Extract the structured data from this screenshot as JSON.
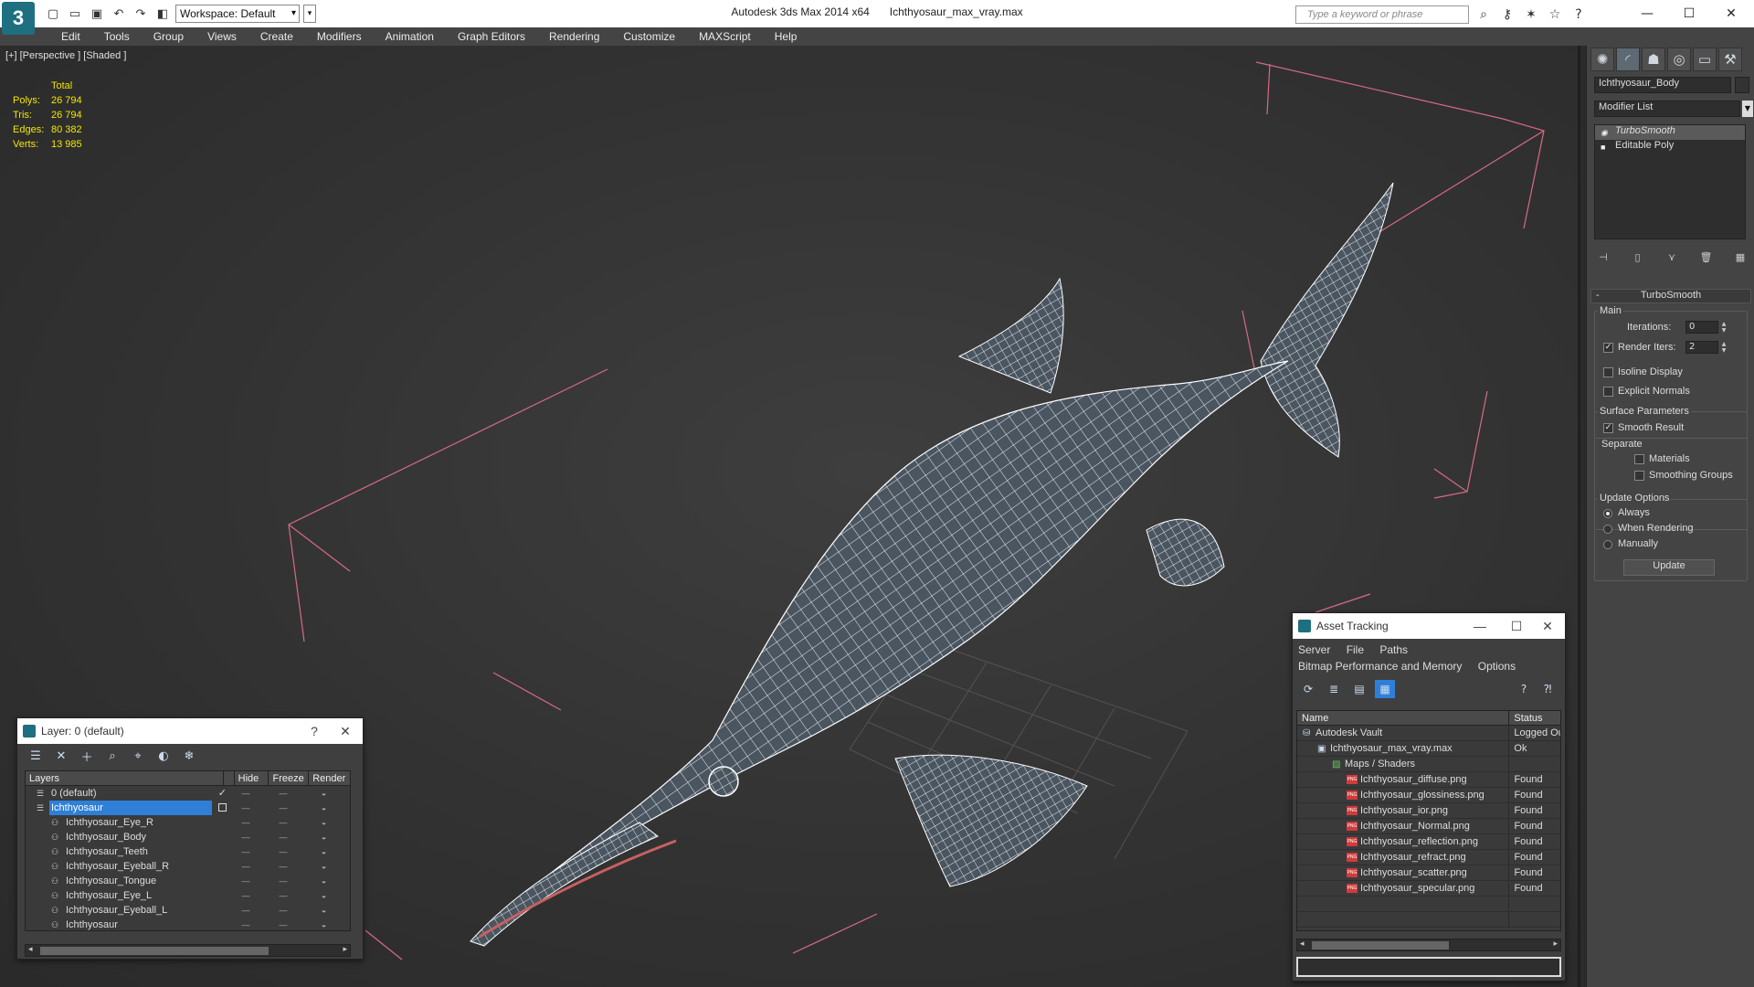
{
  "titlebar": {
    "app_name": "Autodesk 3ds Max 2014 x64",
    "file_name": "Ichthyosaur_max_vray.max",
    "workspace": "Workspace: Default",
    "search_placeholder": "Type a keyword or phrase",
    "logo_glyph": "3",
    "controls": {
      "minimize": "—",
      "maximize": "☐",
      "close": "✕"
    }
  },
  "menu": {
    "items": [
      "Edit",
      "Tools",
      "Group",
      "Views",
      "Create",
      "Modifiers",
      "Animation",
      "Graph Editors",
      "Rendering",
      "Customize",
      "MAXScript",
      "Help"
    ]
  },
  "viewport": {
    "label": "[+] [Perspective ] [Shaded ]",
    "stats": {
      "header": "Total",
      "rows": [
        {
          "key": "Polys:",
          "value": "26 794"
        },
        {
          "key": "Tris:",
          "value": "26 794"
        },
        {
          "key": "Edges:",
          "value": "80 382"
        },
        {
          "key": "Verts:",
          "value": "13 985"
        }
      ]
    },
    "colors": {
      "stats": "#f4e600",
      "bbox": "#d86a86",
      "wire": "#ffffff"
    }
  },
  "command_panel": {
    "object_name": "Ichthyosaur_Body",
    "modifier_list": "Modifier List",
    "stack": [
      "TurboSmooth",
      "Editable Poly"
    ],
    "rollout_title": "TurboSmooth",
    "main_group": "Main",
    "iterations_label": "Iterations:",
    "iterations_value": "0",
    "render_iters_label": "Render Iters:",
    "render_iters_value": "2",
    "isoline_label": "Isoline Display",
    "explicit_normals_label": "Explicit Normals",
    "surface_group": "Surface Parameters",
    "smooth_result_label": "Smooth Result",
    "separate_label": "Separate",
    "materials_label": "Materials",
    "smoothing_groups_label": "Smoothing Groups",
    "update_group": "Update Options",
    "always_label": "Always",
    "when_rendering_label": "When Rendering",
    "manually_label": "Manually",
    "update_button": "Update"
  },
  "layer_window": {
    "title": "Layer: 0 (default)",
    "help": "?",
    "close": "✕",
    "columns": [
      "Layers",
      "Hide",
      "Freeze",
      "Render"
    ],
    "rows": [
      {
        "name": "0 (default)",
        "level": 1,
        "check": "✓"
      },
      {
        "name": "Ichthyosaur",
        "level": 1,
        "selected": true
      },
      {
        "name": "Ichthyosaur_Eye_R",
        "level": 2
      },
      {
        "name": "Ichthyosaur_Body",
        "level": 2
      },
      {
        "name": "Ichthyosaur_Teeth",
        "level": 2
      },
      {
        "name": "Ichthyosaur_Eyeball_R",
        "level": 2
      },
      {
        "name": "Ichthyosaur_Tongue",
        "level": 2
      },
      {
        "name": "Ichthyosaur_Eye_L",
        "level": 2
      },
      {
        "name": "Ichthyosaur_Eyeball_L",
        "level": 2
      },
      {
        "name": "Ichthyosaur",
        "level": 2
      }
    ]
  },
  "asset_window": {
    "title": "Asset Tracking",
    "menu_row1": [
      "Server",
      "File",
      "Paths"
    ],
    "menu_row2": [
      "Bitmap Performance and Memory",
      "Options"
    ],
    "columns": [
      "Name",
      "Status"
    ],
    "rows": [
      {
        "name": "Autodesk Vault",
        "status": "Logged Out",
        "level": 1,
        "icon": "vault"
      },
      {
        "name": "Ichthyosaur_max_vray.max",
        "status": "Ok",
        "level": 2,
        "icon": "max"
      },
      {
        "name": "Maps / Shaders",
        "status": "",
        "level": 3,
        "icon": "maps"
      },
      {
        "name": "Ichthyosaur_diffuse.png",
        "status": "Found",
        "level": 4,
        "icon": "png"
      },
      {
        "name": "Ichthyosaur_glossiness.png",
        "status": "Found",
        "level": 4,
        "icon": "png"
      },
      {
        "name": "Ichthyosaur_ior.png",
        "status": "Found",
        "level": 4,
        "icon": "png"
      },
      {
        "name": "Ichthyosaur_Normal.png",
        "status": "Found",
        "level": 4,
        "icon": "png"
      },
      {
        "name": "Ichthyosaur_reflection.png",
        "status": "Found",
        "level": 4,
        "icon": "png"
      },
      {
        "name": "Ichthyosaur_refract.png",
        "status": "Found",
        "level": 4,
        "icon": "png"
      },
      {
        "name": "Ichthyosaur_scatter.png",
        "status": "Found",
        "level": 4,
        "icon": "png"
      },
      {
        "name": "Ichthyosaur_specular.png",
        "status": "Found",
        "level": 4,
        "icon": "png"
      }
    ]
  }
}
